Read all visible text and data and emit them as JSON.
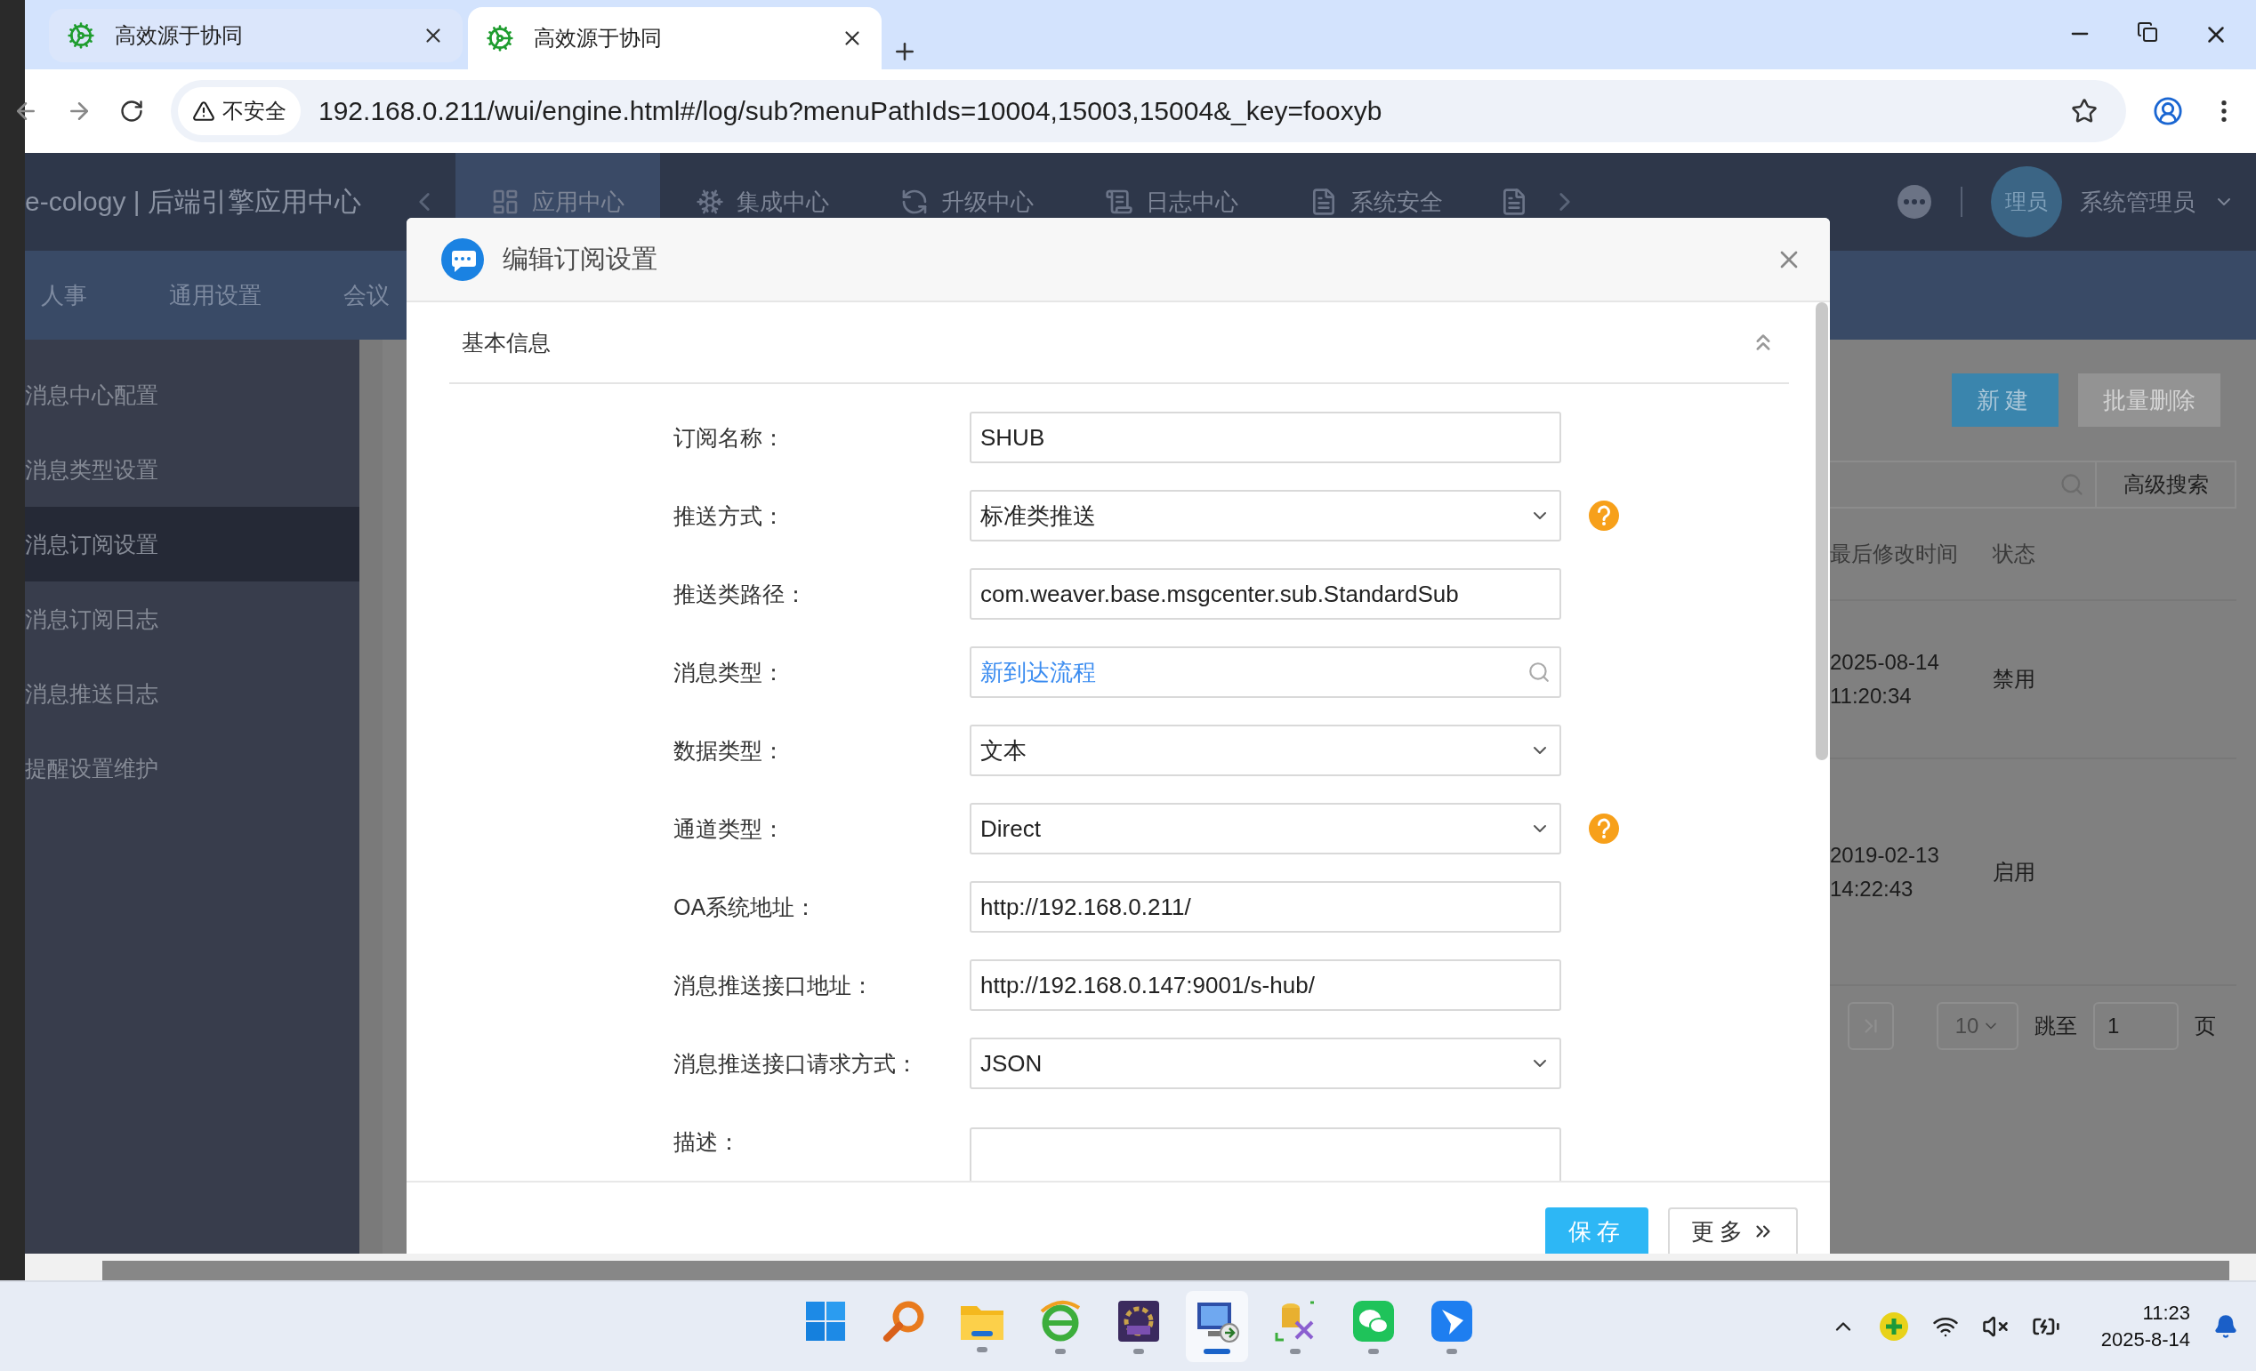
{
  "browser": {
    "tabs": [
      {
        "title": "高效源于协同",
        "selected": false
      },
      {
        "title": "高效源于协同",
        "selected": true
      }
    ],
    "address": {
      "security": "不安全",
      "url": "192.168.0.211/wui/engine.html#/log/sub?menuPathIds=10004,15003,15004&_key=fooxyb"
    }
  },
  "app": {
    "brand": "e-cology | 后端引擎应用中心",
    "nav": [
      {
        "label": "应用中心",
        "kind": "grid",
        "selected": true
      },
      {
        "label": "集成中心",
        "kind": "snow",
        "selected": false
      },
      {
        "label": "升级中心",
        "kind": "cycle",
        "selected": false
      },
      {
        "label": "日志中心",
        "kind": "list",
        "selected": false
      },
      {
        "label": "系统安全",
        "kind": "file",
        "selected": false
      },
      {
        "kind": "file",
        "selected": false
      }
    ],
    "user": {
      "avatar": "理员",
      "name": "系统管理员"
    },
    "subnav": [
      "人事",
      "通用设置",
      "会议"
    ],
    "sidebar": [
      {
        "label": "消息中心配置",
        "selected": false
      },
      {
        "label": "消息类型设置",
        "selected": false
      },
      {
        "label": "消息订阅设置",
        "selected": true
      },
      {
        "label": "消息订阅日志",
        "selected": false
      },
      {
        "label": "消息推送日志",
        "selected": false
      },
      {
        "label": "提醒设置维护",
        "selected": false
      }
    ],
    "toolbar": {
      "buttons": [
        {
          "label": "新建",
          "kind": "primary"
        },
        {
          "label": "批量删除",
          "kind": "disabled"
        }
      ],
      "advanced_search": "高级搜索"
    },
    "table": {
      "columns": [
        "最后修改时间",
        "状态"
      ],
      "rows": [
        [
          "2025-08-14 11:20:34",
          "禁用"
        ],
        [
          "2019-02-13 14:22:43",
          "启用"
        ]
      ]
    },
    "pagination": {
      "page_size": "10",
      "jump_label": "跳至",
      "page": "1",
      "page_suffix": "页"
    }
  },
  "dialog": {
    "title": "编辑订阅设置",
    "section": {
      "title": "基本信息",
      "expanded": true
    },
    "fields": [
      {
        "label": "订阅名称：",
        "kind": "text",
        "value": "SHUB",
        "help": false
      },
      {
        "label": "推送方式：",
        "kind": "select",
        "value": "标准类推送",
        "help": true
      },
      {
        "label": "推送类路径：",
        "kind": "text",
        "value": "com.weaver.base.msgcenter.sub.StandardSub",
        "help": false
      },
      {
        "label": "消息类型：",
        "kind": "browse",
        "value": "新到达流程",
        "help": false
      },
      {
        "label": "数据类型：",
        "kind": "select",
        "value": "文本",
        "help": false
      },
      {
        "label": "通道类型：",
        "kind": "select",
        "value": "Direct",
        "help": true
      },
      {
        "label": "OA系统地址：",
        "kind": "text",
        "value": "http://192.168.0.211/",
        "help": false
      },
      {
        "label": "消息推送接口地址：",
        "kind": "text",
        "value": "http://192.168.0.147:9001/s-hub/",
        "help": false
      },
      {
        "label": "消息推送接口请求方式：",
        "kind": "select",
        "value": "JSON",
        "help": false
      },
      {
        "label": "描述：",
        "kind": "textarea",
        "help": false
      }
    ],
    "buttons": [
      {
        "label": "保存",
        "kind": "primary"
      },
      {
        "label": "更多",
        "kind": "more"
      }
    ]
  },
  "taskbar": {
    "apps": [
      {
        "kind": "start",
        "running": false,
        "selected": false
      },
      {
        "kind": "search",
        "running": false,
        "selected": false
      },
      {
        "kind": "folder",
        "running": true,
        "selected": false
      },
      {
        "kind": "browser",
        "running": true,
        "selected": false
      },
      {
        "kind": "ide",
        "running": true,
        "selected": false
      },
      {
        "kind": "remote",
        "running": true,
        "selected": true
      },
      {
        "kind": "dbtool",
        "running": true,
        "selected": false
      },
      {
        "kind": "chat",
        "running": true,
        "selected": false
      },
      {
        "kind": "bird",
        "running": true,
        "selected": false
      }
    ],
    "clock": {
      "time": "11:23",
      "date": "2025-8-14"
    }
  }
}
